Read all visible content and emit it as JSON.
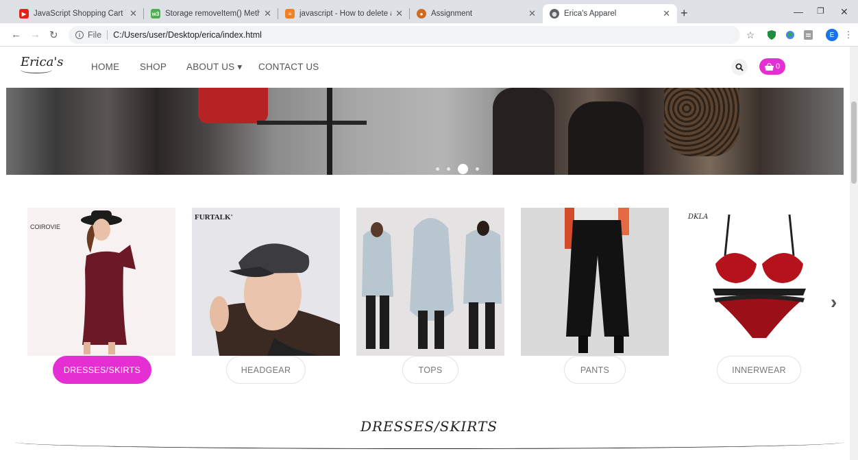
{
  "browser": {
    "tabs": [
      {
        "title": "JavaScript Shopping Cart Tutoria",
        "favicon_color": "#e62117"
      },
      {
        "title": "Storage removeItem() Method",
        "favicon_color": "#4caf50"
      },
      {
        "title": "javascript - How to delete a local",
        "favicon_color": "#f48024"
      },
      {
        "title": "Assignment",
        "favicon_color": "#d36b1f"
      },
      {
        "title": "Erica's Apparel",
        "favicon_color": "#5f6368"
      }
    ],
    "new_tab": "+",
    "address": {
      "scheme_label": "File",
      "url": "C:/Users/user/Desktop/erica/index.html"
    },
    "profile_initial": "E"
  },
  "site": {
    "logo": "Erica's",
    "nav": [
      "HOME",
      "SHOP",
      "ABOUT US",
      "CONTACT US"
    ],
    "nav_dropdown_caret": "▾",
    "cart_count": "0",
    "accent": "#e62fd2"
  },
  "hero": {
    "slide_count": 4,
    "active_slide": 3
  },
  "categories": [
    {
      "label": "DRESSES/SKIRTS",
      "brand": "COIROVIE",
      "active": true
    },
    {
      "label": "HEADGEAR",
      "brand": "FURTALK'",
      "active": false
    },
    {
      "label": "TOPS",
      "brand": "",
      "active": false
    },
    {
      "label": "PANTS",
      "brand": "",
      "active": false
    },
    {
      "label": "INNERWEAR",
      "brand": "DKLA",
      "active": false
    }
  ],
  "carousel": {
    "prev": "‹",
    "next": "›"
  },
  "section": {
    "title": "DRESSES/SKIRTS"
  }
}
